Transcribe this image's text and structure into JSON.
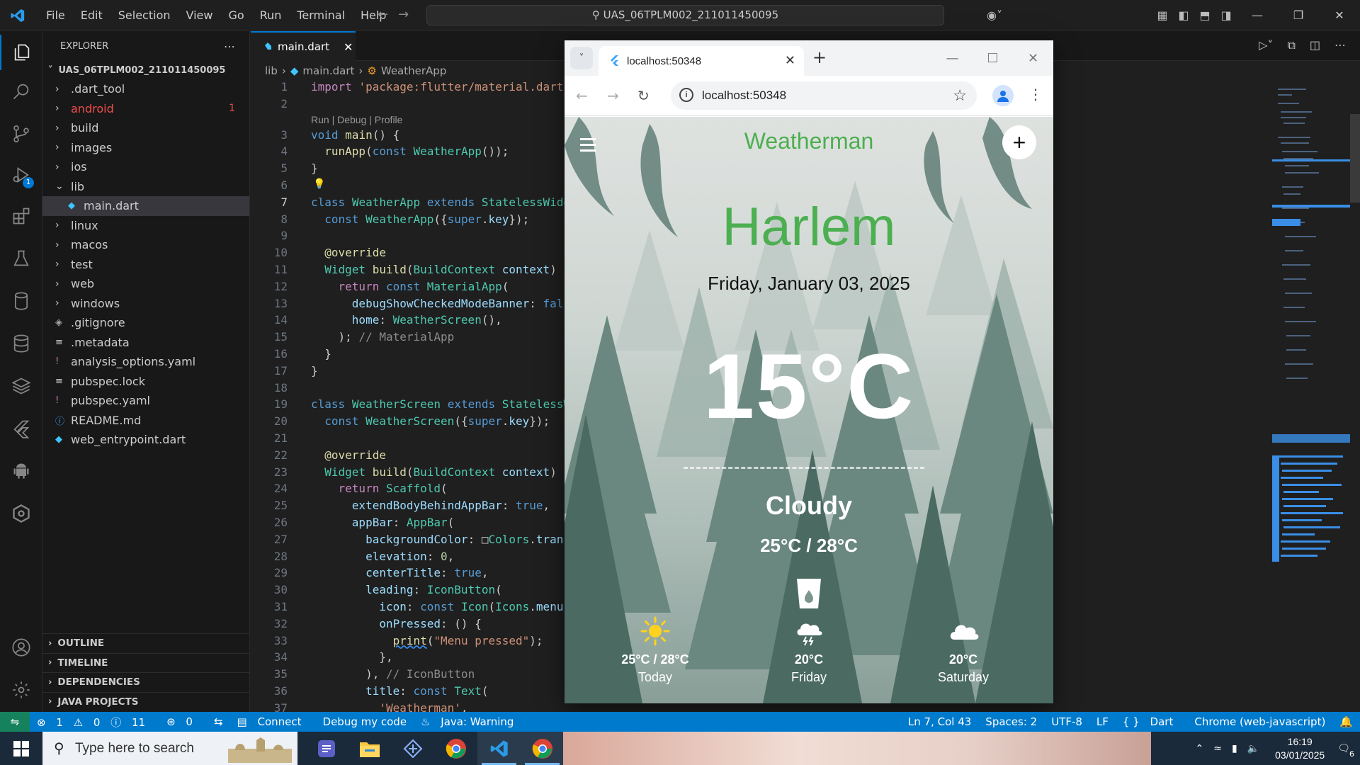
{
  "titlebar": {
    "menu": [
      "File",
      "Edit",
      "Selection",
      "View",
      "Go",
      "Run",
      "Terminal",
      "Help"
    ],
    "search": "UAS_06TPLM002_211011450095"
  },
  "sidebar": {
    "title": "EXPLORER",
    "root": "UAS_06TPLM002_211011450095",
    "items": [
      {
        "label": ".dart_tool",
        "type": "folder"
      },
      {
        "label": "android",
        "type": "folder",
        "badge": "1"
      },
      {
        "label": "build",
        "type": "folder"
      },
      {
        "label": "images",
        "type": "folder"
      },
      {
        "label": "ios",
        "type": "folder"
      },
      {
        "label": "lib",
        "type": "folder-open"
      },
      {
        "label": "main.dart",
        "type": "dart"
      },
      {
        "label": "linux",
        "type": "folder"
      },
      {
        "label": "macos",
        "type": "folder"
      },
      {
        "label": "test",
        "type": "folder"
      },
      {
        "label": "web",
        "type": "folder"
      },
      {
        "label": "windows",
        "type": "folder"
      },
      {
        "label": ".gitignore",
        "type": "git"
      },
      {
        "label": ".metadata",
        "type": "text"
      },
      {
        "label": "analysis_options.yaml",
        "type": "yaml"
      },
      {
        "label": "pubspec.lock",
        "type": "text"
      },
      {
        "label": "pubspec.yaml",
        "type": "yaml"
      },
      {
        "label": "README.md",
        "type": "info"
      },
      {
        "label": "web_entrypoint.dart",
        "type": "dart"
      }
    ],
    "sections": [
      "OUTLINE",
      "TIMELINE",
      "DEPENDENCIES",
      "JAVA PROJECTS"
    ]
  },
  "editor": {
    "tab": "main.dart",
    "breadcrumb": [
      "lib",
      "main.dart",
      "WeatherApp"
    ],
    "codelens": "Run | Debug | Profile",
    "cursor_line": 7
  },
  "statusbar": {
    "problems": "1",
    "warnings": "0",
    "infos": "11",
    "ports": "0",
    "connect": "Connect",
    "debug": "Debug my code",
    "java": "Java: Warning",
    "position": "Ln 7, Col 43",
    "spaces": "Spaces: 2",
    "encoding": "UTF-8",
    "eol": "LF",
    "language": "Dart",
    "device": "Chrome (web-javascript)"
  },
  "browser": {
    "tab_title": "localhost:50348",
    "url": "localhost:50348"
  },
  "weather": {
    "app_title": "Weatherman",
    "city": "Harlem",
    "date": "Friday, January 03, 2025",
    "temp": "15°C",
    "condition": "Cloudy",
    "range": "25°C / 28°C",
    "forecast": [
      {
        "temp": "25°C / 28°C",
        "day": "Today",
        "icon": "sun-icon"
      },
      {
        "temp": "20°C",
        "day": "Friday",
        "icon": "storm-cloud-icon"
      },
      {
        "temp": "20°C",
        "day": "Saturday",
        "icon": "cloud-icon"
      }
    ]
  },
  "taskbar": {
    "search_placeholder": "Type here to search",
    "time": "16:19",
    "date": "03/01/2025",
    "notifications": "6"
  }
}
